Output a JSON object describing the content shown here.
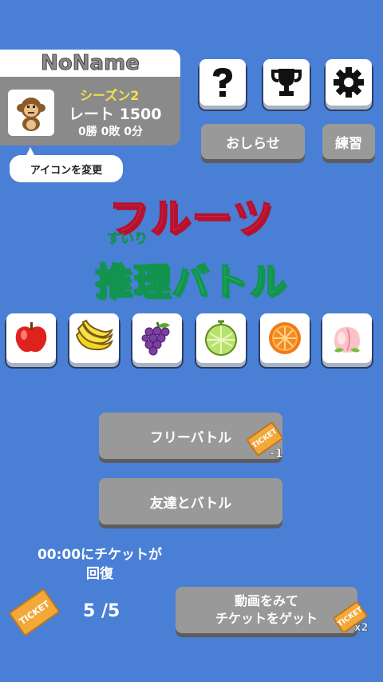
{
  "profile": {
    "name": "NoName",
    "season": "シーズン2",
    "rate": "レート 1500",
    "record": "0勝 0敗 0分",
    "change_icon_label": "アイコンを変更"
  },
  "header_buttons": {
    "help_icon": "question-icon",
    "ranking_icon": "trophy-icon",
    "settings_icon": "gear-icon",
    "news_label": "おしらせ",
    "practice_label": "練習"
  },
  "title": {
    "line1": "フルーツ",
    "ruby": "すいり",
    "line2": "推理バトル"
  },
  "fruits": [
    "apple",
    "banana",
    "grape",
    "melon",
    "orange",
    "peach"
  ],
  "menu": {
    "free_battle_label": "フリーバトル",
    "free_battle_cost": "-1",
    "friend_battle_label": "友達とバトル",
    "ticket_text": "TICKET"
  },
  "tickets": {
    "recover_line1": "00:00にチケットが",
    "recover_line2": "回復",
    "count": "5 /5",
    "watch_video_line1": "動画をみて",
    "watch_video_line2": "チケットをゲット",
    "watch_video_bonus": "x2"
  },
  "colors": {
    "background": "#4a7fd6",
    "title_red": "#ea2a55",
    "title_green": "#2fd27a",
    "season_yellow": "#f5e24a",
    "ticket_orange": "#f2a93a"
  }
}
